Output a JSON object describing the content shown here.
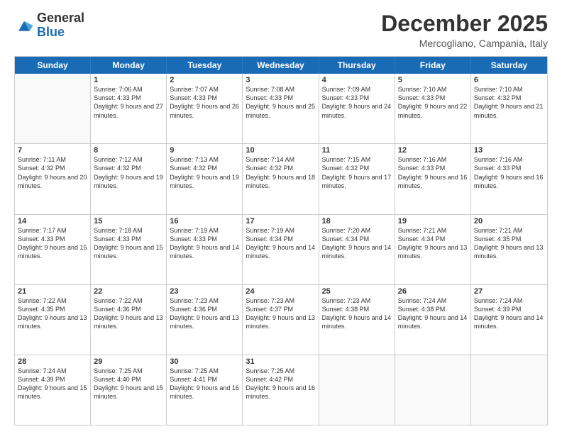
{
  "header": {
    "logo": {
      "line1": "General",
      "line2": "Blue"
    },
    "title": "December 2025",
    "location": "Mercogliano, Campania, Italy"
  },
  "weekdays": [
    "Sunday",
    "Monday",
    "Tuesday",
    "Wednesday",
    "Thursday",
    "Friday",
    "Saturday"
  ],
  "rows": [
    [
      {
        "day": "",
        "sunrise": "",
        "sunset": "",
        "daylight": ""
      },
      {
        "day": "1",
        "sunrise": "Sunrise: 7:06 AM",
        "sunset": "Sunset: 4:33 PM",
        "daylight": "Daylight: 9 hours and 27 minutes."
      },
      {
        "day": "2",
        "sunrise": "Sunrise: 7:07 AM",
        "sunset": "Sunset: 4:33 PM",
        "daylight": "Daylight: 9 hours and 26 minutes."
      },
      {
        "day": "3",
        "sunrise": "Sunrise: 7:08 AM",
        "sunset": "Sunset: 4:33 PM",
        "daylight": "Daylight: 9 hours and 25 minutes."
      },
      {
        "day": "4",
        "sunrise": "Sunrise: 7:09 AM",
        "sunset": "Sunset: 4:33 PM",
        "daylight": "Daylight: 9 hours and 24 minutes."
      },
      {
        "day": "5",
        "sunrise": "Sunrise: 7:10 AM",
        "sunset": "Sunset: 4:33 PM",
        "daylight": "Daylight: 9 hours and 22 minutes."
      },
      {
        "day": "6",
        "sunrise": "Sunrise: 7:10 AM",
        "sunset": "Sunset: 4:32 PM",
        "daylight": "Daylight: 9 hours and 21 minutes."
      }
    ],
    [
      {
        "day": "7",
        "sunrise": "Sunrise: 7:11 AM",
        "sunset": "Sunset: 4:32 PM",
        "daylight": "Daylight: 9 hours and 20 minutes."
      },
      {
        "day": "8",
        "sunrise": "Sunrise: 7:12 AM",
        "sunset": "Sunset: 4:32 PM",
        "daylight": "Daylight: 9 hours and 19 minutes."
      },
      {
        "day": "9",
        "sunrise": "Sunrise: 7:13 AM",
        "sunset": "Sunset: 4:32 PM",
        "daylight": "Daylight: 9 hours and 19 minutes."
      },
      {
        "day": "10",
        "sunrise": "Sunrise: 7:14 AM",
        "sunset": "Sunset: 4:32 PM",
        "daylight": "Daylight: 9 hours and 18 minutes."
      },
      {
        "day": "11",
        "sunrise": "Sunrise: 7:15 AM",
        "sunset": "Sunset: 4:32 PM",
        "daylight": "Daylight: 9 hours and 17 minutes."
      },
      {
        "day": "12",
        "sunrise": "Sunrise: 7:16 AM",
        "sunset": "Sunset: 4:33 PM",
        "daylight": "Daylight: 9 hours and 16 minutes."
      },
      {
        "day": "13",
        "sunrise": "Sunrise: 7:16 AM",
        "sunset": "Sunset: 4:33 PM",
        "daylight": "Daylight: 9 hours and 16 minutes."
      }
    ],
    [
      {
        "day": "14",
        "sunrise": "Sunrise: 7:17 AM",
        "sunset": "Sunset: 4:33 PM",
        "daylight": "Daylight: 9 hours and 15 minutes."
      },
      {
        "day": "15",
        "sunrise": "Sunrise: 7:18 AM",
        "sunset": "Sunset: 4:33 PM",
        "daylight": "Daylight: 9 hours and 15 minutes."
      },
      {
        "day": "16",
        "sunrise": "Sunrise: 7:19 AM",
        "sunset": "Sunset: 4:33 PM",
        "daylight": "Daylight: 9 hours and 14 minutes."
      },
      {
        "day": "17",
        "sunrise": "Sunrise: 7:19 AM",
        "sunset": "Sunset: 4:34 PM",
        "daylight": "Daylight: 9 hours and 14 minutes."
      },
      {
        "day": "18",
        "sunrise": "Sunrise: 7:20 AM",
        "sunset": "Sunset: 4:34 PM",
        "daylight": "Daylight: 9 hours and 14 minutes."
      },
      {
        "day": "19",
        "sunrise": "Sunrise: 7:21 AM",
        "sunset": "Sunset: 4:34 PM",
        "daylight": "Daylight: 9 hours and 13 minutes."
      },
      {
        "day": "20",
        "sunrise": "Sunrise: 7:21 AM",
        "sunset": "Sunset: 4:35 PM",
        "daylight": "Daylight: 9 hours and 13 minutes."
      }
    ],
    [
      {
        "day": "21",
        "sunrise": "Sunrise: 7:22 AM",
        "sunset": "Sunset: 4:35 PM",
        "daylight": "Daylight: 9 hours and 13 minutes."
      },
      {
        "day": "22",
        "sunrise": "Sunrise: 7:22 AM",
        "sunset": "Sunset: 4:36 PM",
        "daylight": "Daylight: 9 hours and 13 minutes."
      },
      {
        "day": "23",
        "sunrise": "Sunrise: 7:23 AM",
        "sunset": "Sunset: 4:36 PM",
        "daylight": "Daylight: 9 hours and 13 minutes."
      },
      {
        "day": "24",
        "sunrise": "Sunrise: 7:23 AM",
        "sunset": "Sunset: 4:37 PM",
        "daylight": "Daylight: 9 hours and 13 minutes."
      },
      {
        "day": "25",
        "sunrise": "Sunrise: 7:23 AM",
        "sunset": "Sunset: 4:38 PM",
        "daylight": "Daylight: 9 hours and 14 minutes."
      },
      {
        "day": "26",
        "sunrise": "Sunrise: 7:24 AM",
        "sunset": "Sunset: 4:38 PM",
        "daylight": "Daylight: 9 hours and 14 minutes."
      },
      {
        "day": "27",
        "sunrise": "Sunrise: 7:24 AM",
        "sunset": "Sunset: 4:39 PM",
        "daylight": "Daylight: 9 hours and 14 minutes."
      }
    ],
    [
      {
        "day": "28",
        "sunrise": "Sunrise: 7:24 AM",
        "sunset": "Sunset: 4:39 PM",
        "daylight": "Daylight: 9 hours and 15 minutes."
      },
      {
        "day": "29",
        "sunrise": "Sunrise: 7:25 AM",
        "sunset": "Sunset: 4:40 PM",
        "daylight": "Daylight: 9 hours and 15 minutes."
      },
      {
        "day": "30",
        "sunrise": "Sunrise: 7:25 AM",
        "sunset": "Sunset: 4:41 PM",
        "daylight": "Daylight: 9 hours and 16 minutes."
      },
      {
        "day": "31",
        "sunrise": "Sunrise: 7:25 AM",
        "sunset": "Sunset: 4:42 PM",
        "daylight": "Daylight: 9 hours and 16 minutes."
      },
      {
        "day": "",
        "sunrise": "",
        "sunset": "",
        "daylight": ""
      },
      {
        "day": "",
        "sunrise": "",
        "sunset": "",
        "daylight": ""
      },
      {
        "day": "",
        "sunrise": "",
        "sunset": "",
        "daylight": ""
      }
    ]
  ]
}
